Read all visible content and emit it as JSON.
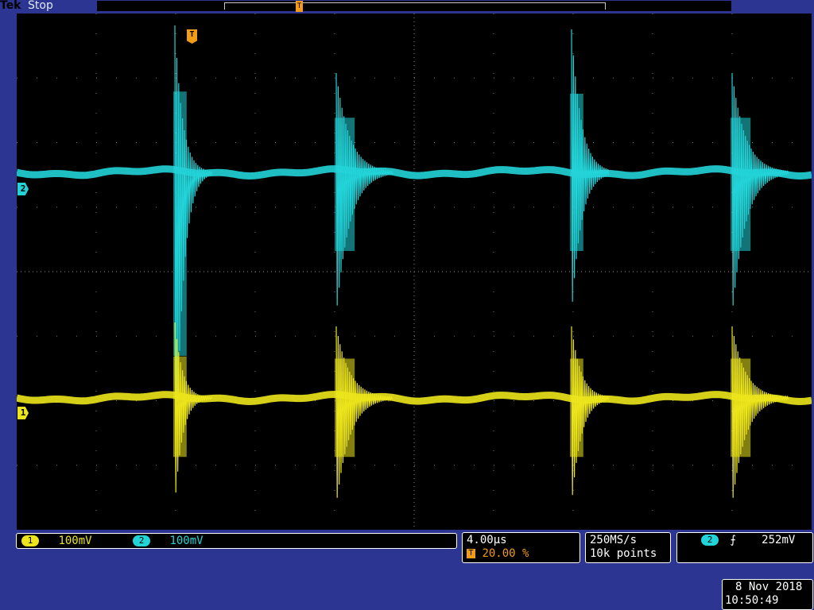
{
  "header": {
    "brand": "Tek",
    "run_status": "Stop",
    "trigger_position_label": "T"
  },
  "screen": {
    "channel2_marker": "2",
    "channel1_marker": "1",
    "trigger_marker": "T",
    "trigger_level_marker": "◂"
  },
  "channels": [
    {
      "badge": "1",
      "scale": "100mV",
      "color": "#ece51b"
    },
    {
      "badge": "2",
      "scale": "100mV",
      "color": "#22d3d8"
    }
  ],
  "timebase": {
    "scale": "4.00µs",
    "trigger_icon": "T",
    "position": "20.00 %"
  },
  "acquisition": {
    "sample_rate": "250MS/s",
    "record_length": "10k points"
  },
  "trigger": {
    "source_badge": "2",
    "slope_icon": "rising-edge-icon",
    "slope_glyph": "⨍",
    "level": "252mV"
  },
  "datetime": {
    "date": "8 Nov 2018",
    "time": "10:50:49"
  },
  "colors": {
    "background": "#2c3591",
    "ch1": "#ece51b",
    "ch2": "#22d3d8",
    "trigger": "#f29b16"
  }
}
